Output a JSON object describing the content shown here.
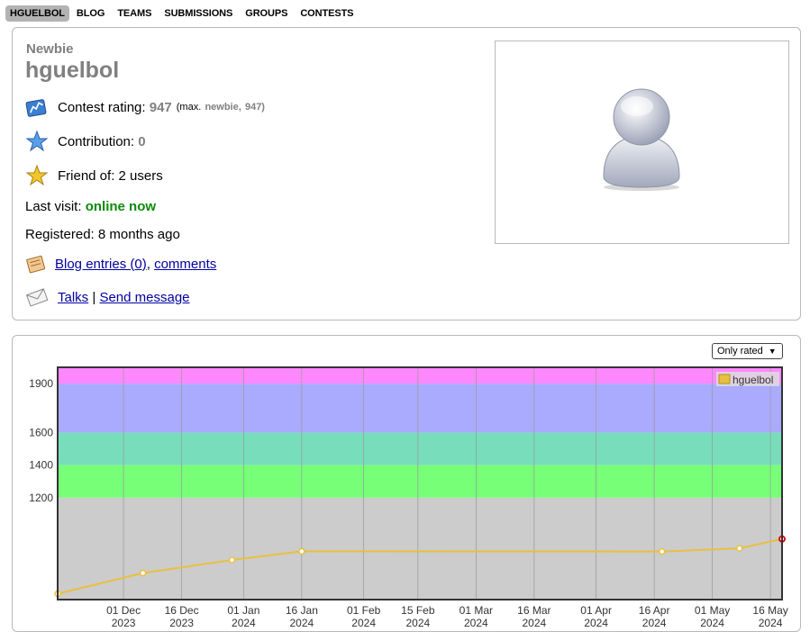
{
  "nav": {
    "items": [
      "HGUELBOL",
      "BLOG",
      "TEAMS",
      "SUBMISSIONS",
      "GROUPS",
      "CONTESTS"
    ],
    "active": "HGUELBOL"
  },
  "profile": {
    "rank": "Newbie",
    "handle": "hguelbol",
    "rating_label": "Contest rating:",
    "rating_value": "947",
    "rating_max_prefix": "(max.",
    "rating_max_rank": "newbie,",
    "rating_max_value": "947)",
    "contribution_label": "Contribution:",
    "contribution_value": "0",
    "friend_label": "Friend of:",
    "friend_value": "2 users",
    "last_visit_label": "Last visit:",
    "last_visit_value": "online now",
    "registered_label": "Registered:",
    "registered_value": "8 months ago",
    "blog_link": "Blog entries (0)",
    "comments_link": "comments",
    "talks_link": "Talks",
    "separator": "|",
    "send_message_link": "Send message",
    "comma": ","
  },
  "icons": {
    "rating": "rating-chart-icon",
    "contribution": "blue-star-icon",
    "friend": "gold-star-icon",
    "blog": "notebook-icon",
    "talks": "envelope-icon",
    "avatar": "user-silhouette-icon"
  },
  "filter": {
    "selected": "Only rated"
  },
  "colors": {
    "rank_gray": "#808080",
    "online_green": "#0a8a0a",
    "line": "#e8c040",
    "band_gray": "#cccccc",
    "band_green": "#77ff77",
    "band_cyan": "#77ddbb",
    "band_blue": "#aaaaff",
    "band_violet": "#ff88ff"
  },
  "chart_data": {
    "type": "line",
    "title": "",
    "xlabel": "",
    "ylabel": "",
    "legend": "top-right",
    "series": [
      {
        "name": "hguelbol",
        "color": "#e8c040",
        "points": [
          {
            "x": "2023-11-14",
            "y": 611
          },
          {
            "x": "2023-12-06",
            "y": 738
          },
          {
            "x": "2023-12-29",
            "y": 818
          },
          {
            "x": "2024-01-16",
            "y": 871
          },
          {
            "x": "2024-04-18",
            "y": 870
          },
          {
            "x": "2024-05-08",
            "y": 889
          },
          {
            "x": "2024-05-19",
            "y": 947
          }
        ]
      }
    ],
    "yticks": [
      1200,
      1400,
      1600,
      1900
    ],
    "ylim": [
      575,
      2000
    ],
    "xlim": [
      "2023-11-14",
      "2024-05-19"
    ],
    "xticks": [
      {
        "date": "2023-12-01",
        "l1": "01 Dec",
        "l2": "2023"
      },
      {
        "date": "2023-12-16",
        "l1": "16 Dec",
        "l2": "2023"
      },
      {
        "date": "2024-01-01",
        "l1": "01 Jan",
        "l2": "2024"
      },
      {
        "date": "2024-01-16",
        "l1": "16 Jan",
        "l2": "2024"
      },
      {
        "date": "2024-02-01",
        "l1": "01 Feb",
        "l2": "2024"
      },
      {
        "date": "2024-02-15",
        "l1": "15 Feb",
        "l2": "2024"
      },
      {
        "date": "2024-03-01",
        "l1": "01 Mar",
        "l2": "2024"
      },
      {
        "date": "2024-03-16",
        "l1": "16 Mar",
        "l2": "2024"
      },
      {
        "date": "2024-04-01",
        "l1": "01 Apr",
        "l2": "2024"
      },
      {
        "date": "2024-04-16",
        "l1": "16 Apr",
        "l2": "2024"
      },
      {
        "date": "2024-05-01",
        "l1": "01 May",
        "l2": "2024"
      },
      {
        "date": "2024-05-16",
        "l1": "16 May",
        "l2": "2024"
      }
    ],
    "bands": [
      {
        "from": 0,
        "to": 1200,
        "color": "#cccccc"
      },
      {
        "from": 1200,
        "to": 1400,
        "color": "#77ff77"
      },
      {
        "from": 1400,
        "to": 1600,
        "color": "#77ddbb"
      },
      {
        "from": 1600,
        "to": 1900,
        "color": "#aaaaff"
      },
      {
        "from": 1900,
        "to": 2100,
        "color": "#ff88ff"
      }
    ]
  }
}
